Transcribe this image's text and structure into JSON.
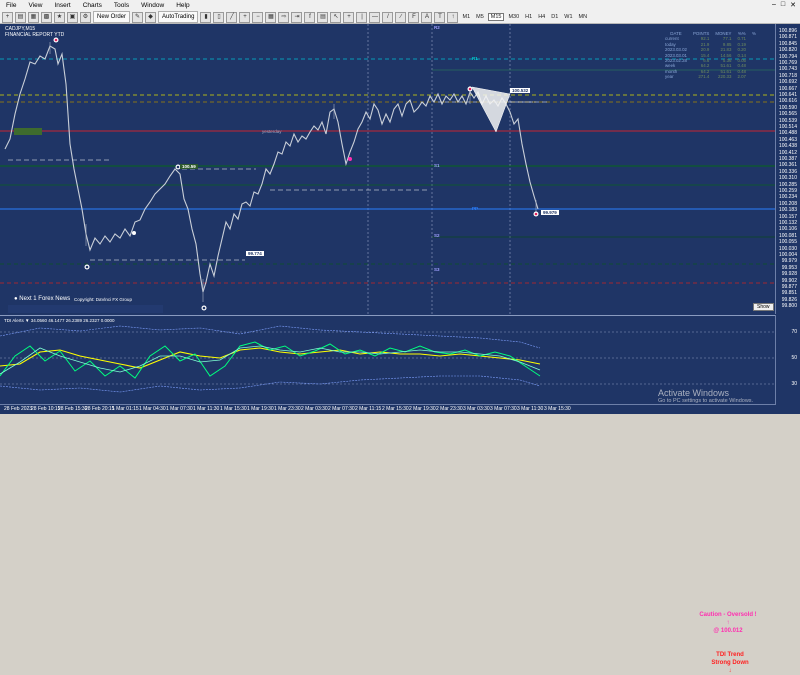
{
  "menu": [
    "File",
    "View",
    "Insert",
    "Charts",
    "Tools",
    "Window",
    "Help"
  ],
  "toolbar": {
    "new_order": "New Order",
    "auto_trading": "AutoTrading",
    "timeframes": [
      "M1",
      "M5",
      "M15",
      "M30",
      "H1",
      "H4",
      "D1",
      "W1",
      "MN"
    ]
  },
  "chart": {
    "symbol_line": "CADJPY,M15",
    "indicator_line": "FINANCIAL REPORT YTD",
    "price_labels": [
      "100.896",
      "100.871",
      "100.845",
      "100.820",
      "100.794",
      "100.769",
      "100.743",
      "100.718",
      "100.692",
      "100.667",
      "100.641",
      "100.616",
      "100.590",
      "100.565",
      "100.539",
      "100.514",
      "100.488",
      "100.463",
      "100.438",
      "100.412",
      "100.387",
      "100.361",
      "100.336",
      "100.310",
      "100.285",
      "100.259",
      "100.234",
      "100.208",
      "100.183",
      "100.157",
      "100.132",
      "100.106",
      "100.081",
      "100.055",
      "100.030",
      "100.004",
      "99.979",
      "99.953",
      "99.928",
      "99.902",
      "99.877",
      "99.851",
      "99.826",
      "99.800"
    ],
    "last_price": "100.012",
    "time_labels": [
      "28 Feb 2023",
      "28 Feb 10:15",
      "28 Feb 15:30",
      "28 Feb 20:15",
      "1 Mar 01:15",
      "1 Mar 04:30",
      "1 Mar 07:30",
      "1 Mar 11:30",
      "1 Mar 15:30",
      "1 Mar 19:30",
      "1 Mar 23:30",
      "2 Mar 03:30",
      "2 Mar 07:30",
      "2 Mar 11:15",
      "2 Mar 15:30",
      "2 Mar 19:30",
      "2 Mar 23:30",
      "3 Mar 03:30",
      "3 Mar 07:30",
      "3 Mar 11:30",
      "3 Mar 15:30"
    ],
    "markers": [
      "100.59",
      "100.532",
      "100.11",
      "99.979",
      "99.774"
    ],
    "level_names": [
      "R2",
      "R1",
      "S1",
      "S2",
      "S3",
      "PP"
    ],
    "yesterday": "yesterday",
    "news": "Next 1 Forex News",
    "copyright": "Copyright: DaVinci FX Group",
    "show": "Show"
  },
  "stats": {
    "headers": [
      "DATE",
      "POINTS",
      "MONEY",
      "%%",
      "%"
    ],
    "rows": [
      [
        "current",
        "92.1",
        "77.1",
        "0.71"
      ],
      [
        "today",
        "21.9",
        "9.85",
        "0.19"
      ],
      [
        "2023.03.02",
        "20.9",
        "21.83",
        "0.20"
      ],
      [
        "2023.03.01",
        "15.4",
        "14.56",
        "0.14"
      ],
      [
        "2023.02.28",
        "6.6",
        "5.36",
        "0.05"
      ],
      [
        "week",
        "64.2",
        "51.61",
        "0.48"
      ],
      [
        "month",
        "64.2",
        "51.61",
        "0.48"
      ],
      [
        "year",
        "271.4",
        "220.33",
        "2.07"
      ]
    ]
  },
  "indicator": {
    "title": "TDI Alerts ▼ 34.0560 46.1477 26.2389 26.2327 0.0000",
    "levels": [
      "70",
      "50",
      "30"
    ],
    "caution": "Caution - Oversold !",
    "caution_price": "@ 100.012",
    "trend1": "TDI Trend",
    "trend2": "Strong Down"
  },
  "watermark": {
    "title": "Activate Windows",
    "subtitle": "Go to PC settings to activate Windows."
  },
  "colors": {
    "bg": "#1f3566",
    "candles": "#c9cfd8",
    "ma_yellow": "#ffff00",
    "ma_green": "#00ff7f",
    "ma_cyan": "#7fffd4",
    "resistance": "#ff4040",
    "support": "#00aa00"
  }
}
